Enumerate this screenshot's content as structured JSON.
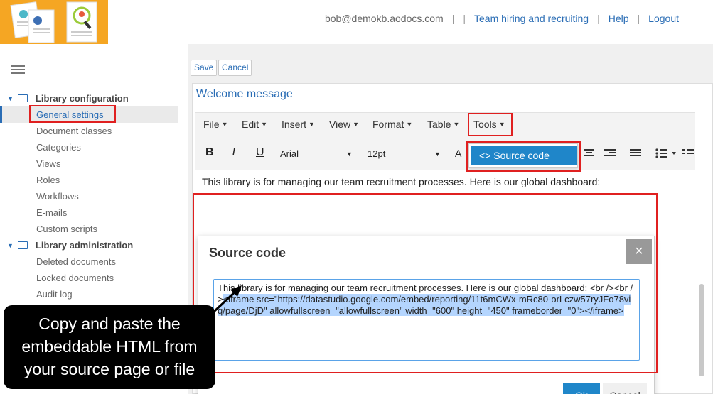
{
  "header": {
    "user_email": "bob@demokb.aodocs.com",
    "separator": "|",
    "links": [
      "Team hiring and recruiting",
      "Help",
      "Logout"
    ]
  },
  "sidebar": {
    "section1": "Library configuration",
    "section1_items": [
      "General settings",
      "Document classes",
      "Categories",
      "Views",
      "Roles",
      "Workflows",
      "E-mails",
      "Custom scripts"
    ],
    "section2": "Library administration",
    "section2_items": [
      "Deleted documents",
      "Locked documents",
      "Audit log"
    ]
  },
  "toolbar": {
    "save_label": "Save",
    "cancel_label": "Cancel"
  },
  "panel": {
    "title": "Welcome message"
  },
  "editor": {
    "menus": [
      "File",
      "Edit",
      "Insert",
      "View",
      "Format",
      "Table",
      "Tools"
    ],
    "font_family": "Arial",
    "font_size": "12pt",
    "tools_option": "Source code",
    "tools_option_icon": "<>",
    "body_text": "This library is for managing our team recruitment processes. Here is our global dashboard:"
  },
  "modal": {
    "title": "Source code",
    "close_glyph": "×",
    "code_plain": "This library is for managing our team recruitment processes. Here is our global dashboard: <br /><br />",
    "code_selected": "<iframe src=\"https://datastudio.google.com/embed/reporting/11t6mCWx-mRc80-orLczw57ryJFo78viq/page/DjD\" allowfullscreen=\"allowfullscreen\" width=\"600\" height=\"450\" frameborder=\"0\"></iframe>",
    "ok_label": "Ok",
    "cancel_label": "Cancel"
  },
  "annotation": {
    "text": "Copy and paste the embeddable HTML from your source page or file"
  },
  "colors": {
    "accent": "#2a6db5",
    "primary_button": "#1f86c9",
    "highlight_box": "#e02020",
    "logo_bg": "#f5a623"
  }
}
